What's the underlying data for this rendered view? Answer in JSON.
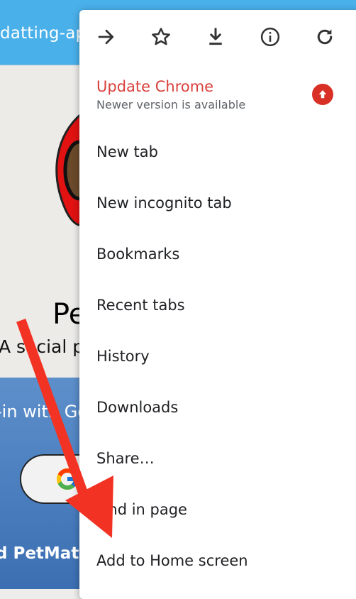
{
  "background_page": {
    "url_fragment": "datting-app",
    "title_fragment": "Pe",
    "tagline_fragment": "A social pla",
    "signin_fragment": "-in with Go",
    "brand_fragment": "d PetMatch"
  },
  "menu": {
    "toolbar": {
      "forward_icon": "arrow-forward-icon",
      "bookmark_icon": "star-icon",
      "download_icon": "download-icon",
      "info_icon": "info-icon",
      "reload_icon": "reload-icon"
    },
    "update": {
      "title": "Update Chrome",
      "subtitle": "Newer version is available",
      "color": "#d9413b"
    },
    "items": [
      "New tab",
      "New incognito tab",
      "Bookmarks",
      "Recent tabs",
      "History",
      "Downloads",
      "Share…",
      "Find in page",
      "Add to Home screen"
    ]
  },
  "colors": {
    "url_bar": "#4ab0ea",
    "annotation_arrow": "#f23324",
    "blue_panel": "#4a7fbf"
  }
}
